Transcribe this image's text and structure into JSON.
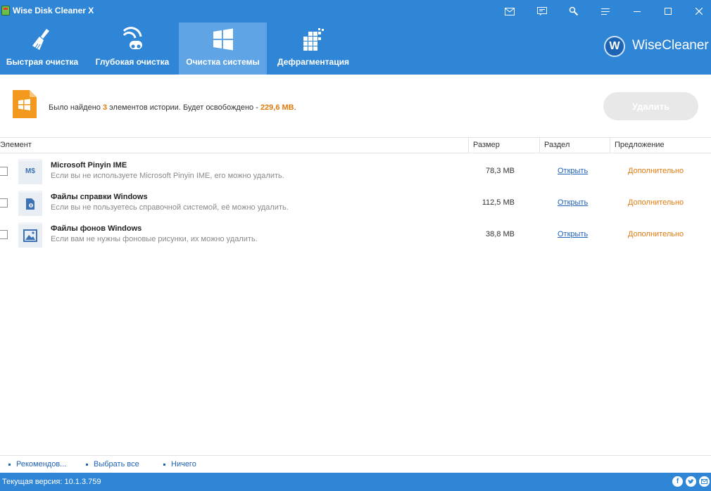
{
  "window": {
    "title": "Wise Disk Cleaner X"
  },
  "titlebar_icons": [
    "mail-icon",
    "feedback-icon",
    "tools-icon",
    "menu-icon",
    "minimize-icon",
    "maximize-icon",
    "close-icon"
  ],
  "tabs": [
    {
      "label": "Быстрая очистка",
      "icon": "broom-icon",
      "active": false
    },
    {
      "label": "Глубокая очистка",
      "icon": "vacuum-icon",
      "active": false
    },
    {
      "label": "Очистка системы",
      "icon": "windows-icon",
      "active": true
    },
    {
      "label": "Дефрагментация",
      "icon": "defrag-icon",
      "active": false
    }
  ],
  "brand": {
    "logo_letter": "W",
    "name": "WiseCleaner"
  },
  "summary": {
    "prefix": "Было найдено ",
    "count": "3",
    "middle": " элементов истории. Будет освобождено - ",
    "size": "229,6 MB",
    "suffix": ".",
    "delete_label": "Удалить"
  },
  "table": {
    "headers": {
      "element": "Элемент",
      "size": "Размер",
      "section": "Раздел",
      "suggestion": "Предложение"
    },
    "rows": [
      {
        "name": "Microsoft Pinyin IME",
        "description": "Если вы не используете Microsoft Pinyin IME, его можно удалить.",
        "size": "78,3 MB",
        "open": "Открыть",
        "more": "Дополнительно",
        "icon": "ime-icon",
        "glyph": "M$"
      },
      {
        "name": "Файлы справки Windows",
        "description": "Если вы не пользуетесь справочной системой, её можно удалить.",
        "size": "112,5 MB",
        "open": "Открыть",
        "more": "Дополнительно",
        "icon": "help-file-icon",
        "glyph": ""
      },
      {
        "name": "Файлы фонов Windows",
        "description": "Если вам не нужны фоновые рисунки, их можно удалить.",
        "size": "38,8 MB",
        "open": "Открыть",
        "more": "Дополнительно",
        "icon": "wallpaper-icon",
        "glyph": ""
      }
    ]
  },
  "bottom_links": {
    "recommended": "Рекомендов...",
    "select_all": "Выбрать все",
    "none": "Ничего"
  },
  "status": {
    "version": "Текущая версия: 10.1.3.759"
  },
  "colors": {
    "header_blue": "#2f86d6",
    "active_tab": "#5fa4e4",
    "accent_orange": "#e07b0f",
    "link_blue": "#1f62b6"
  }
}
